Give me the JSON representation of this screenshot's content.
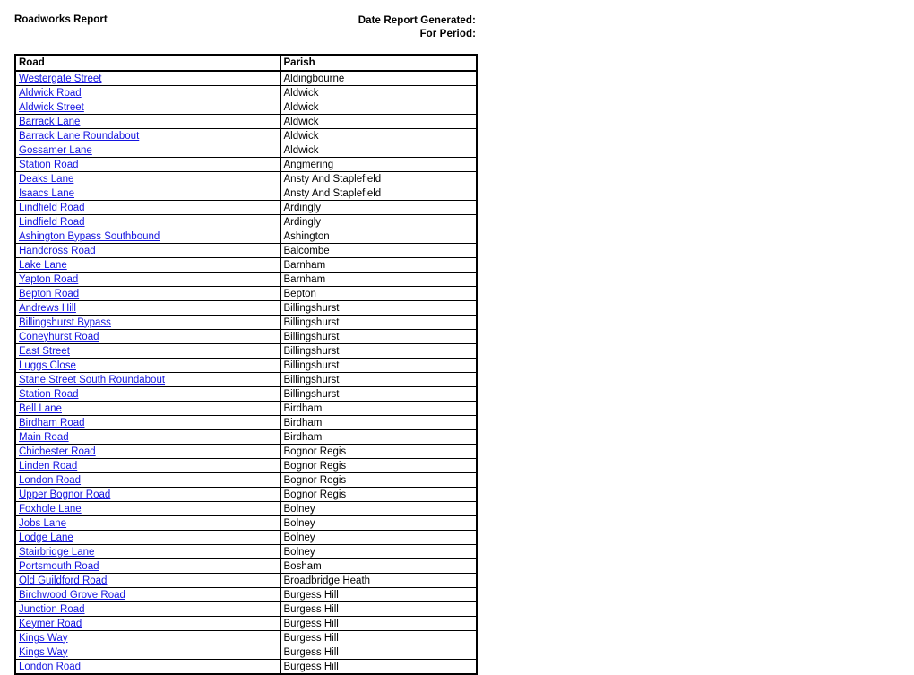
{
  "header": {
    "title": "Roadworks Report",
    "date_generated_label": "Date Report Generated:",
    "for_period_label": "For Period:"
  },
  "table": {
    "columns": [
      "Road",
      "Parish"
    ],
    "rows": [
      {
        "road": "Westergate Street",
        "parish": "Aldingbourne"
      },
      {
        "road": "Aldwick Road",
        "parish": "Aldwick"
      },
      {
        "road": "Aldwick Street",
        "parish": "Aldwick"
      },
      {
        "road": "Barrack Lane",
        "parish": "Aldwick"
      },
      {
        "road": "Barrack Lane Roundabout",
        "parish": "Aldwick"
      },
      {
        "road": "Gossamer Lane",
        "parish": "Aldwick"
      },
      {
        "road": "Station Road",
        "parish": "Angmering"
      },
      {
        "road": "Deaks Lane",
        "parish": "Ansty And Staplefield"
      },
      {
        "road": "Isaacs Lane",
        "parish": "Ansty And Staplefield"
      },
      {
        "road": "Lindfield Road",
        "parish": "Ardingly"
      },
      {
        "road": "Lindfield Road",
        "parish": "Ardingly"
      },
      {
        "road": "Ashington Bypass Southbound",
        "parish": "Ashington"
      },
      {
        "road": "Handcross Road",
        "parish": "Balcombe"
      },
      {
        "road": "Lake Lane",
        "parish": "Barnham"
      },
      {
        "road": "Yapton Road",
        "parish": "Barnham"
      },
      {
        "road": "Bepton Road",
        "parish": "Bepton"
      },
      {
        "road": "Andrews Hill",
        "parish": "Billingshurst"
      },
      {
        "road": "Billingshurst Bypass",
        "parish": "Billingshurst"
      },
      {
        "road": "Coneyhurst Road",
        "parish": "Billingshurst"
      },
      {
        "road": "East Street",
        "parish": "Billingshurst"
      },
      {
        "road": "Luggs Close",
        "parish": "Billingshurst"
      },
      {
        "road": "Stane Street South Roundabout",
        "parish": "Billingshurst"
      },
      {
        "road": "Station Road",
        "parish": "Billingshurst"
      },
      {
        "road": "Bell Lane",
        "parish": "Birdham"
      },
      {
        "road": "Birdham Road",
        "parish": "Birdham"
      },
      {
        "road": "Main Road",
        "parish": "Birdham"
      },
      {
        "road": "Chichester Road",
        "parish": "Bognor Regis"
      },
      {
        "road": "Linden Road",
        "parish": "Bognor Regis"
      },
      {
        "road": "London Road",
        "parish": "Bognor Regis"
      },
      {
        "road": "Upper Bognor Road",
        "parish": "Bognor Regis"
      },
      {
        "road": "Foxhole Lane",
        "parish": "Bolney"
      },
      {
        "road": "Jobs Lane",
        "parish": "Bolney"
      },
      {
        "road": "Lodge Lane",
        "parish": "Bolney"
      },
      {
        "road": "Stairbridge Lane",
        "parish": "Bolney"
      },
      {
        "road": "Portsmouth Road",
        "parish": "Bosham"
      },
      {
        "road": "Old Guildford Road",
        "parish": "Broadbridge Heath"
      },
      {
        "road": "Birchwood Grove Road",
        "parish": "Burgess Hill"
      },
      {
        "road": "Junction Road",
        "parish": "Burgess Hill"
      },
      {
        "road": "Keymer Road",
        "parish": "Burgess Hill"
      },
      {
        "road": "Kings Way",
        "parish": "Burgess Hill"
      },
      {
        "road": "Kings Way",
        "parish": "Burgess Hill"
      },
      {
        "road": "London Road",
        "parish": "Burgess Hill"
      }
    ]
  },
  "colors": {
    "link": "#1414e0",
    "text": "#000000",
    "border": "#000000"
  }
}
